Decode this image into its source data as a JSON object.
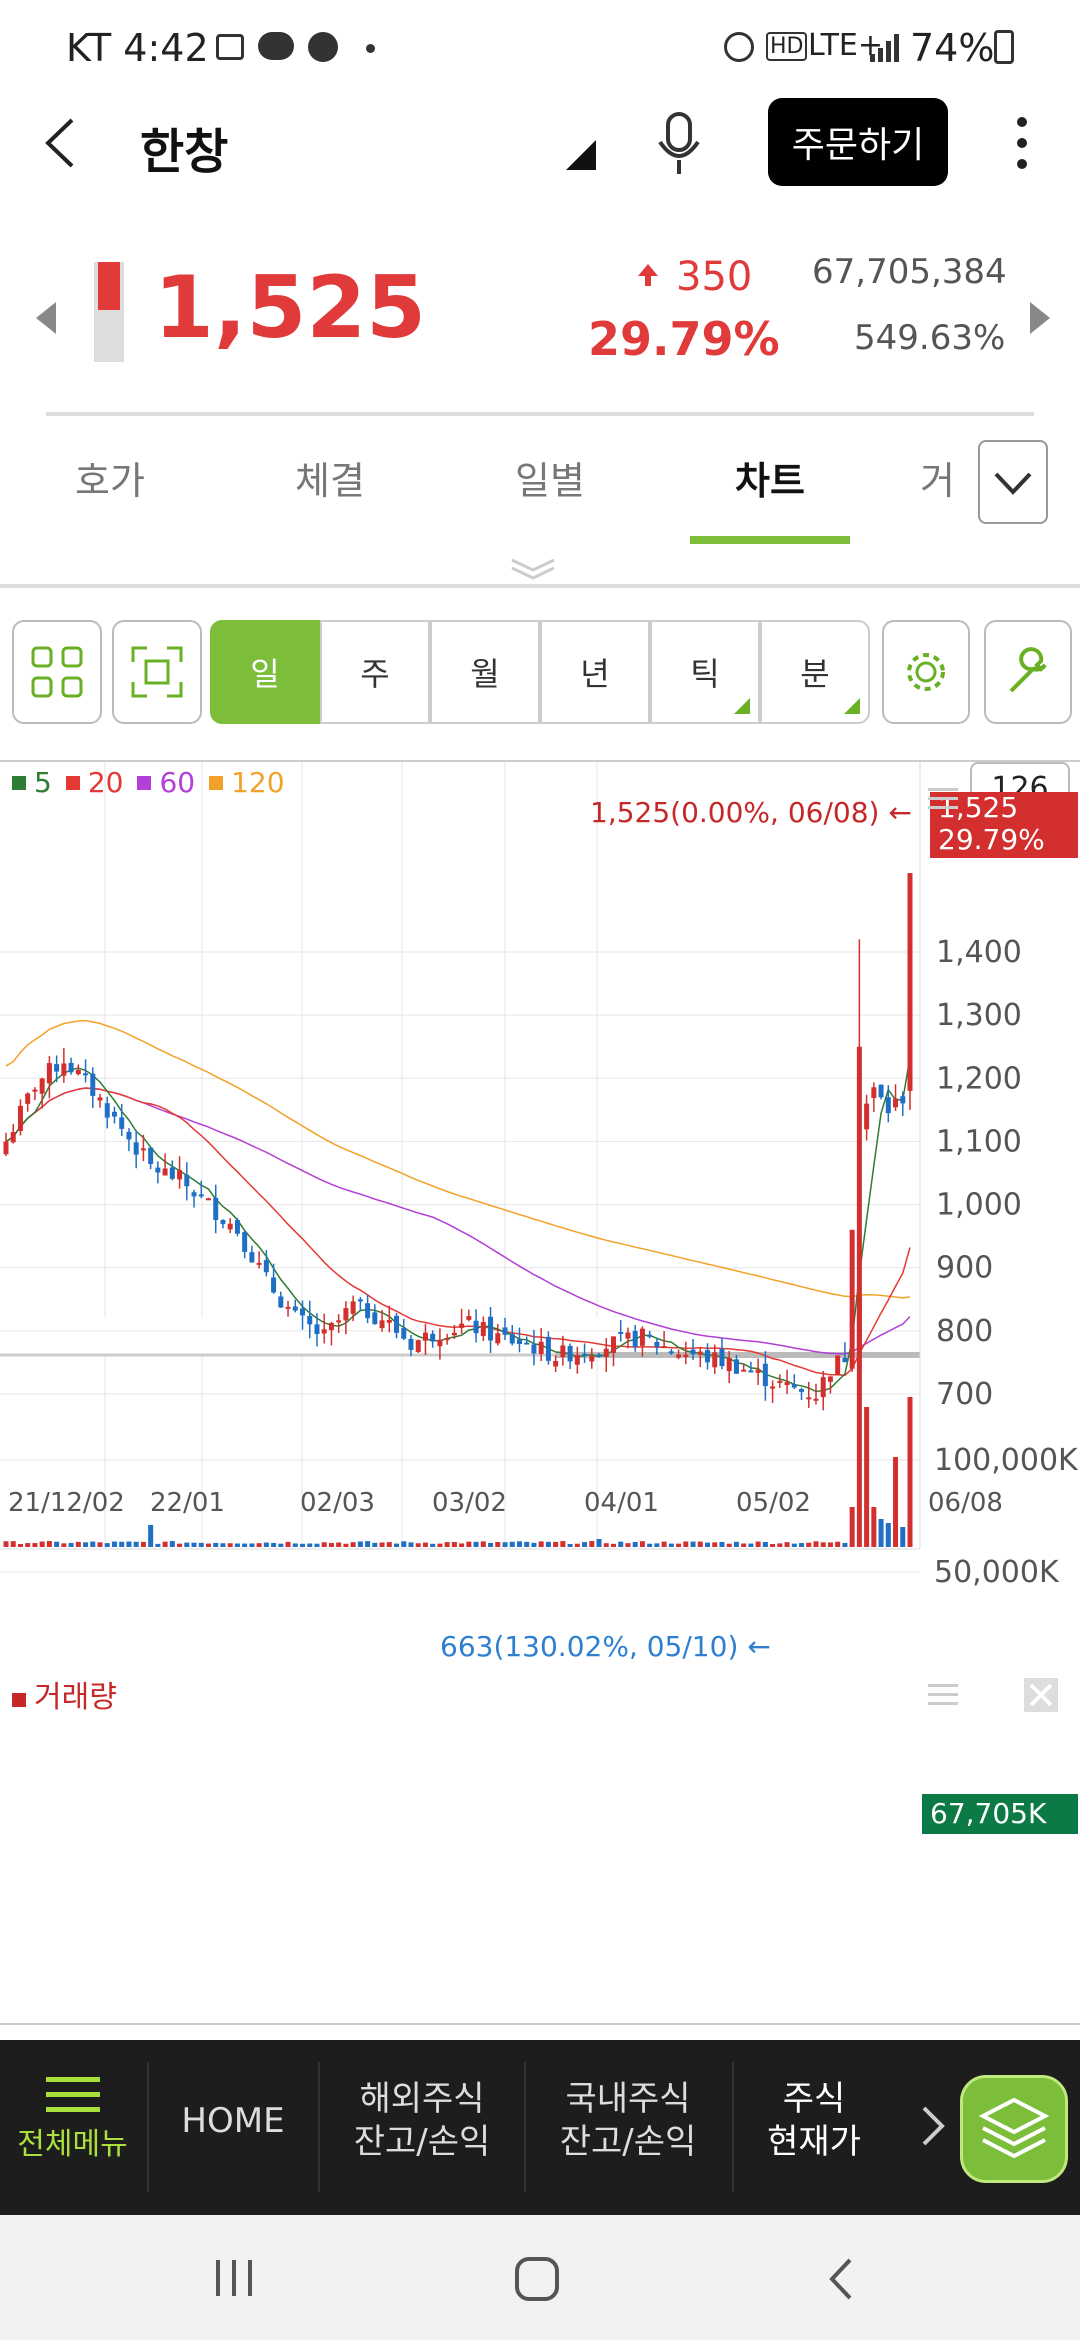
{
  "status": {
    "carrier": "KT",
    "time": "4:42",
    "battery": "74%",
    "network": "LTE+"
  },
  "header": {
    "title": "한창",
    "order_label": "주문하기"
  },
  "quote": {
    "price": "1,525",
    "change": "350",
    "change_pct": "29.79%",
    "volume": "67,705,384",
    "volume_pct": "549.63%"
  },
  "tabs": [
    {
      "label": "호가",
      "active": false
    },
    {
      "label": "체결",
      "active": false
    },
    {
      "label": "일별",
      "active": false
    },
    {
      "label": "차트",
      "active": true
    },
    {
      "label": "거",
      "active": false
    }
  ],
  "periods": [
    {
      "label": "일",
      "active": true
    },
    {
      "label": "주",
      "active": false
    },
    {
      "label": "월",
      "active": false
    },
    {
      "label": "년",
      "active": false
    },
    {
      "label": "틱",
      "active": false
    },
    {
      "label": "분",
      "active": false
    }
  ],
  "chart": {
    "legend": [
      {
        "label": "5",
        "color": "#2e7d32"
      },
      {
        "label": "20",
        "color": "#e53935"
      },
      {
        "label": "60",
        "color": "#b23fd6"
      },
      {
        "label": "120",
        "color": "#f2a22a"
      }
    ],
    "count_badge": "126",
    "last_marker": "1,525(0.00%, 06/08)",
    "last_badge_price": "1,525",
    "last_badge_pct": "29.79%",
    "low_marker": "663(130.02%, 05/10)",
    "volume_title": "거래량",
    "volume_badge": "67,705K"
  },
  "chart_data": {
    "type": "candlestick",
    "price_ticks": [
      "1,400",
      "1,300",
      "1,200",
      "1,100",
      "1,000",
      "900",
      "800",
      "700"
    ],
    "volume_ticks": [
      "100,000K",
      "50,000K"
    ],
    "x_ticks": [
      "21/12/02",
      "22/01",
      "02/03",
      "03/02",
      "04/01",
      "05/02",
      "06/08"
    ],
    "last_close": 1525,
    "period_low": 663,
    "volume_last": 67705384
  },
  "bottom_nav": [
    {
      "label": "전체메뉴"
    },
    {
      "label": "HOME"
    },
    {
      "line1": "해외주식",
      "line2": "잔고/손익"
    },
    {
      "line1": "국내주식",
      "line2": "잔고/손익"
    },
    {
      "line1": "주식",
      "line2": "현재가"
    }
  ]
}
